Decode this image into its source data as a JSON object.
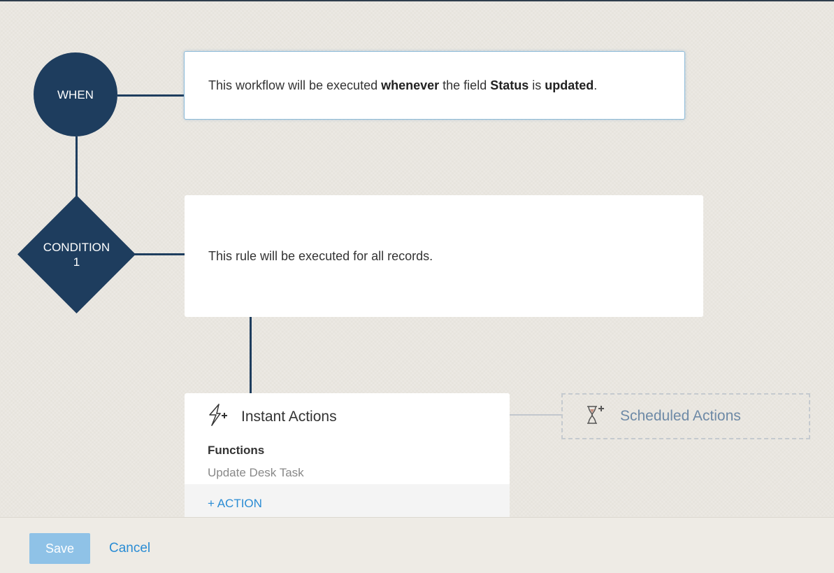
{
  "nodes": {
    "when": "WHEN",
    "condition_line1": "CONDITION",
    "condition_line2": "1"
  },
  "when_card": {
    "t1": "This workflow will be executed ",
    "b1": "whenever",
    "t2": " the field ",
    "b2": "Status",
    "t3": " is ",
    "b3": "updated",
    "t4": "."
  },
  "condition_card": {
    "text": "This rule will be executed for all records."
  },
  "instant_actions": {
    "title": "Instant Actions",
    "section_heading": "Functions",
    "items": [
      "Update Desk Task"
    ],
    "add_action_label": "+ ACTION",
    "icon": "lightning-plus-icon"
  },
  "scheduled_actions": {
    "title": "Scheduled Actions",
    "icon": "hourglass-plus-icon"
  },
  "footer": {
    "save_label": "Save",
    "cancel_label": "Cancel"
  },
  "colors": {
    "node": "#1e3d5e",
    "link": "#2a8cd4",
    "save_button": "#8fc2e7",
    "scheduled_text": "#6d89a6"
  }
}
